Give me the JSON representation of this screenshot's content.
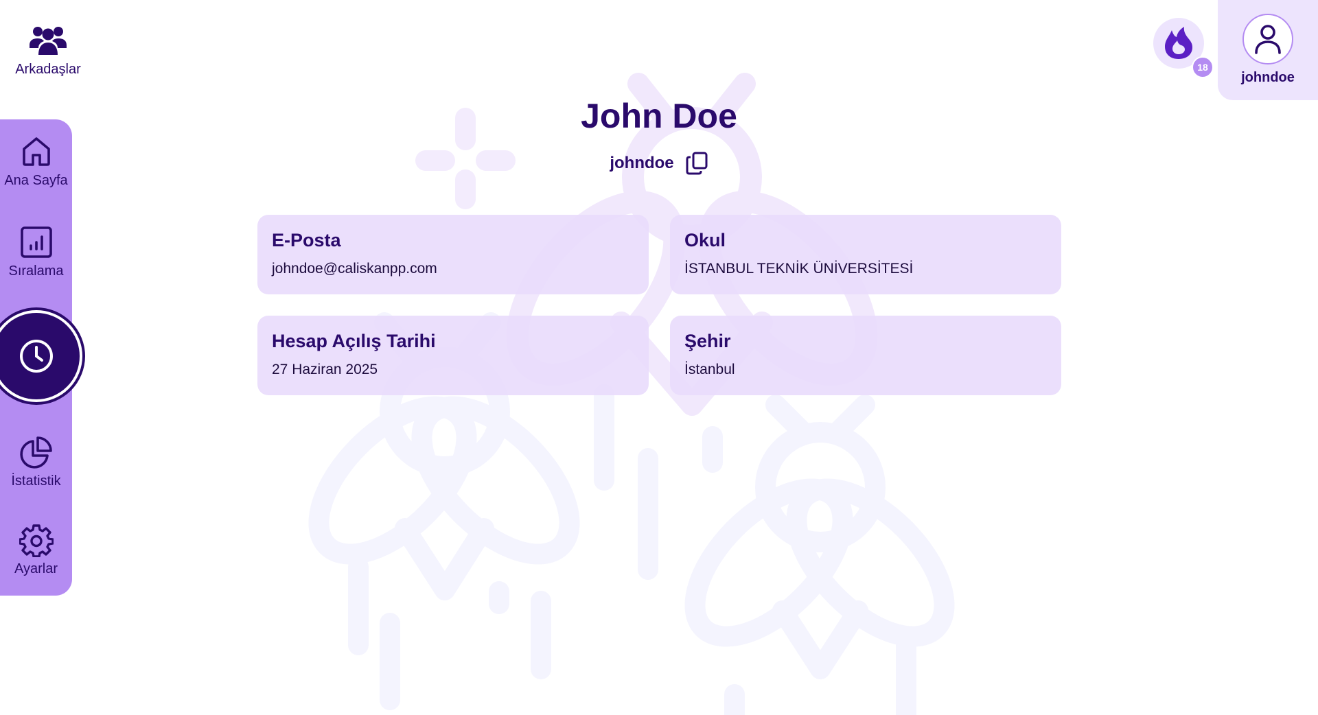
{
  "friends": {
    "label": "Arkadaşlar",
    "icon": "users-icon"
  },
  "sidebar": {
    "items": [
      {
        "label": "Ana Sayfa",
        "icon": "home-icon"
      },
      {
        "label": "Sıralama",
        "icon": "bar-chart-icon"
      },
      {
        "label": "",
        "icon": "clock-icon",
        "active": true
      },
      {
        "label": "İstatistik",
        "icon": "pie-chart-icon"
      },
      {
        "label": "Ayarlar",
        "icon": "gear-icon"
      }
    ]
  },
  "header": {
    "streak": {
      "icon": "flame-icon",
      "count": "18"
    },
    "profile": {
      "username": "johndoe",
      "icon": "user-icon"
    }
  },
  "profile": {
    "name": "John Doe",
    "username": "johndoe",
    "fields": [
      {
        "title": "E-Posta",
        "value": "johndoe@caliskanpp.com"
      },
      {
        "title": "Okul",
        "value": "İSTANBUL TEKNİK ÜNİVERSİTESİ"
      },
      {
        "title": "Hesap Açılış Tarihi",
        "value": "27 Haziran 2025"
      },
      {
        "title": "Şehir",
        "value": "İstanbul"
      }
    ]
  },
  "colors": {
    "primary": "#2a0a6b",
    "sidebar": "#b48cf2",
    "card": "#e8dbfc",
    "background": "#ffffff"
  }
}
